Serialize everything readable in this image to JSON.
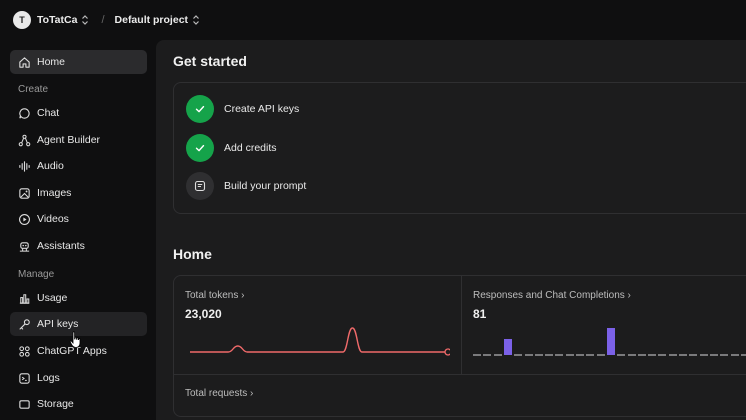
{
  "header": {
    "org_initial": "T",
    "org_name": "ToTatCa",
    "separator": "/",
    "project_name": "Default project"
  },
  "sidebar": {
    "home": "Home",
    "section_create": "Create",
    "create_items": [
      "Chat",
      "Agent Builder",
      "Audio",
      "Images",
      "Videos",
      "Assistants"
    ],
    "section_manage": "Manage",
    "manage_items": [
      "Usage",
      "API keys",
      "ChatGPT Apps",
      "Logs",
      "Storage"
    ]
  },
  "get_started": {
    "title": "Get started",
    "steps": [
      {
        "label": "Create API keys",
        "done": true
      },
      {
        "label": "Add credits",
        "done": true
      },
      {
        "label": "Build your prompt",
        "done": false
      }
    ]
  },
  "home": {
    "title": "Home",
    "total_tokens_title": "Total tokens",
    "total_tokens_value": "23,020",
    "responses_title": "Responses and Chat Completions",
    "responses_value": "81",
    "total_requests_title": "Total requests"
  },
  "colors": {
    "accent_green": "#15a34a",
    "line_series": "#f06a6a",
    "bar_series": "#7b61e8"
  },
  "chart_data": [
    {
      "type": "line",
      "title": "Total tokens",
      "x": [
        1,
        2,
        3,
        4,
        5,
        6,
        7,
        8,
        9,
        10,
        11,
        12,
        13,
        14,
        15,
        16,
        17,
        18,
        19,
        20,
        21,
        22,
        23,
        24,
        25,
        26,
        27,
        28
      ],
      "series": [
        {
          "values": [
            0,
            0,
            0,
            0,
            0,
            0.25,
            0,
            0,
            0,
            0,
            0,
            0,
            0,
            0,
            0,
            0,
            0,
            1,
            0,
            0,
            0,
            0,
            0,
            0,
            0,
            0,
            0,
            0
          ]
        }
      ]
    },
    {
      "type": "bar",
      "title": "Responses and Chat Completions",
      "x": [
        1,
        2,
        3,
        4,
        5,
        6,
        7,
        8,
        9,
        10,
        11,
        12,
        13,
        14,
        15,
        16,
        17,
        18,
        19,
        20,
        21,
        22,
        23,
        24,
        25,
        26,
        27,
        28
      ],
      "series": [
        {
          "values": [
            0,
            0,
            0,
            16,
            0,
            0,
            0,
            0,
            0,
            0,
            0,
            0,
            0,
            27,
            0,
            0,
            0,
            0,
            0,
            0,
            0,
            0,
            0,
            0,
            0,
            0,
            0,
            0
          ]
        }
      ]
    }
  ]
}
